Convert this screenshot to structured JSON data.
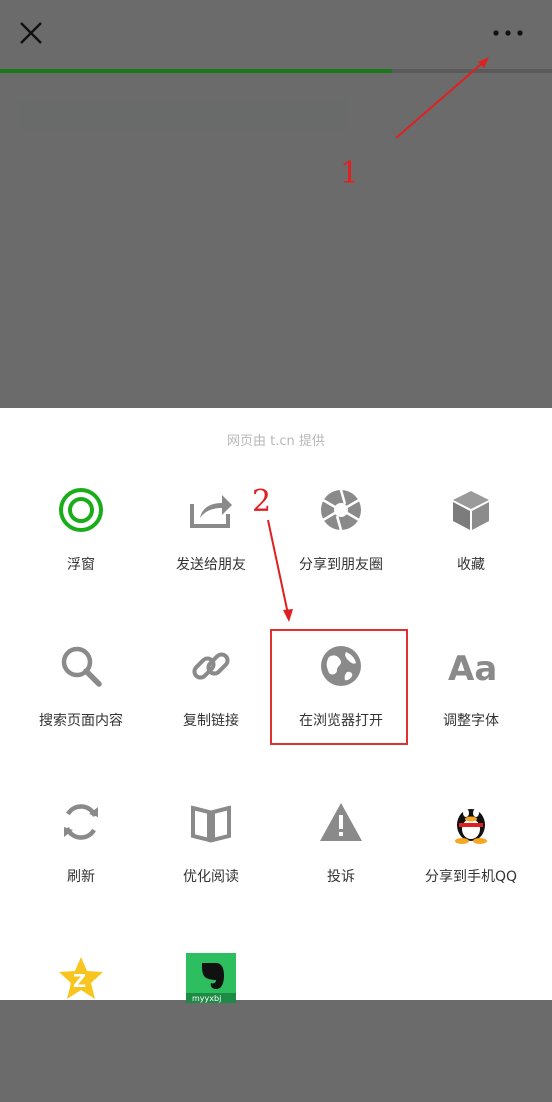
{
  "colors": {
    "accent_green": "#1aad19",
    "annotation_red": "#e02020",
    "icon_gray": "#8a8a8a"
  },
  "topbar": {
    "close_icon": "close-icon",
    "more_icon": "more-dots-icon"
  },
  "progress": {
    "loaded_fraction": 0.71
  },
  "sheet": {
    "provider_text": "网页由 t.cn 提供",
    "items": [
      {
        "label": "浮窗",
        "icon": "floating-window-icon"
      },
      {
        "label": "发送给朋友",
        "icon": "share-icon"
      },
      {
        "label": "分享到朋友圈",
        "icon": "moments-icon"
      },
      {
        "label": "收藏",
        "icon": "favorite-icon"
      },
      {
        "label": "搜索页面内容",
        "icon": "search-icon"
      },
      {
        "label": "复制链接",
        "icon": "link-icon"
      },
      {
        "label": "在浏览器打开",
        "icon": "globe-icon"
      },
      {
        "label": "调整字体",
        "icon": "font-icon"
      },
      {
        "label": "刷新",
        "icon": "refresh-icon"
      },
      {
        "label": "优化阅读",
        "icon": "reader-icon"
      },
      {
        "label": "投诉",
        "icon": "warning-icon"
      },
      {
        "label": "分享到手机QQ",
        "icon": "qq-icon"
      },
      {
        "label": "",
        "icon": "qzone-icon"
      },
      {
        "label": "",
        "icon": "evernote-icon",
        "thumb_text": "myyxbj"
      }
    ]
  },
  "annotations": {
    "step1": "1",
    "step2": "2"
  }
}
